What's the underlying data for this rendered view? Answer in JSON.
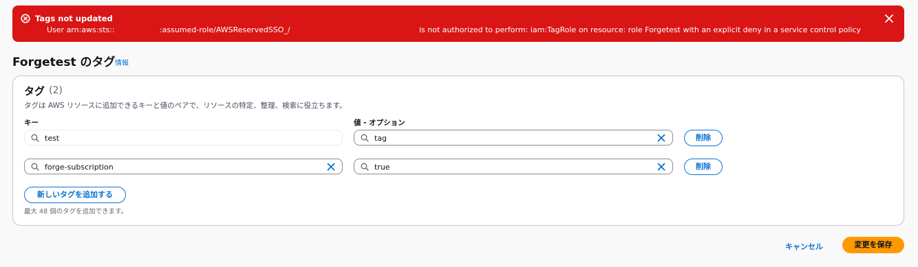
{
  "flash": {
    "title": "Tags not updated",
    "message_part1": "User arn:aws:sts::",
    "message_part2": ":assumed-role/AWSReservedSSO_/",
    "message_part3": "is not authorized to perform: iam:TagRole on resource: role Forgetest with an explicit deny in a service control policy",
    "icon": "error-circle-icon",
    "close_icon": "close-icon",
    "background_color": "#d91515"
  },
  "header": {
    "title": "Forgetest のタグ",
    "info_link": "情報"
  },
  "tags_panel": {
    "title": "タグ",
    "count": "(2)",
    "description": "タグは AWS リソースに追加できるキーと値のペアで、リソースの特定、整理、検索に役立ちます。",
    "key_label": "キー",
    "value_label": "値 - オプション",
    "rows": [
      {
        "key": "test",
        "value": "tag",
        "remove_label": "削除"
      },
      {
        "key": "forge-subscription",
        "value": "true",
        "remove_label": "削除"
      }
    ],
    "add_button": "新しいタグを追加する",
    "limit_note": "最大 48 個のタグを追加できます。"
  },
  "footer": {
    "cancel_label": "キャンセル",
    "save_label": "変更を保存",
    "accent_color": "#ff9900",
    "link_color": "#0972d3"
  }
}
